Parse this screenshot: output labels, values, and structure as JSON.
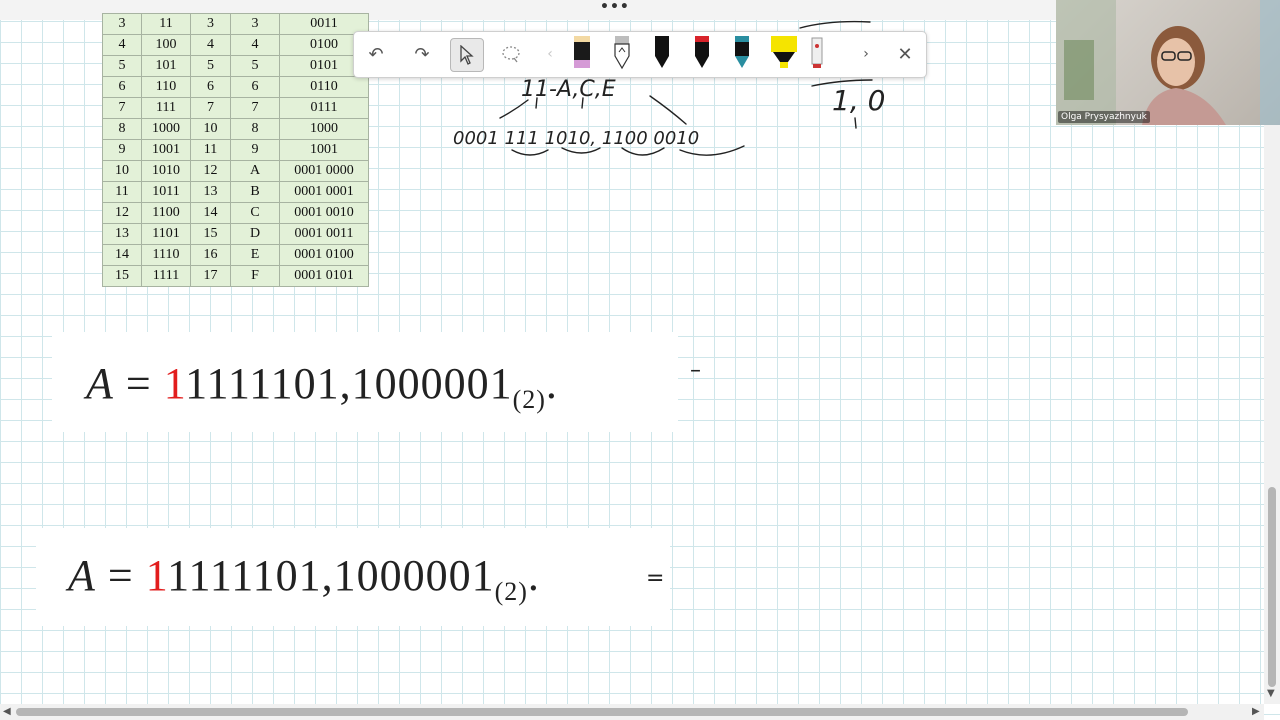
{
  "number_table": {
    "rows": [
      [
        "3",
        "11",
        "3",
        "3",
        "0011"
      ],
      [
        "4",
        "100",
        "4",
        "4",
        "0100"
      ],
      [
        "5",
        "101",
        "5",
        "5",
        "0101"
      ],
      [
        "6",
        "110",
        "6",
        "6",
        "0110"
      ],
      [
        "7",
        "111",
        "7",
        "7",
        "0111"
      ],
      [
        "8",
        "1000",
        "10",
        "8",
        "1000"
      ],
      [
        "9",
        "1001",
        "11",
        "9",
        "1001"
      ],
      [
        "10",
        "1010",
        "12",
        "A",
        "0001 0000"
      ],
      [
        "11",
        "1011",
        "13",
        "B",
        "0001 0001"
      ],
      [
        "12",
        "1100",
        "14",
        "C",
        "0001 0010"
      ],
      [
        "13",
        "1101",
        "15",
        "D",
        "0001 0011"
      ],
      [
        "14",
        "1110",
        "16",
        "E",
        "0001 0100"
      ],
      [
        "15",
        "1111",
        "17",
        "F",
        "0001 0101"
      ]
    ]
  },
  "handwriting": {
    "letters": "11-A,C,E",
    "groups": "0001 111 1010, 1100 0010",
    "top_right": "1, 0"
  },
  "toolbar": {
    "icons": [
      "undo-icon",
      "redo-icon",
      "select-pointer-icon",
      "lasso-icon",
      "scroll-left-icon",
      "pen-black-pink",
      "pencil-gray",
      "pen-black",
      "pen-red",
      "pen-teal",
      "highlighter-yellow",
      "ruler-eraser",
      "scroll-right-icon",
      "close-icon"
    ],
    "pen_colors": [
      "#1a1a1a",
      "#9a9a9a",
      "#111111",
      "#d8232a",
      "#2a8ea0",
      "#f5e400",
      "#cc3333"
    ]
  },
  "formula1": {
    "lhs": "A",
    "eq": "=",
    "mark": "1",
    "digits": "1111101,1000001",
    "sub": "(2)",
    "dot": ".",
    "dash": "–"
  },
  "formula2": {
    "lhs": "A",
    "eq": "=",
    "mark": "1",
    "digits": "1111101,1000001",
    "sub": "(2)",
    "dot": ".",
    "dash": "="
  },
  "participant": {
    "name": "Olga Prysyazhnyuk"
  },
  "topbar": {
    "menu": "•••"
  }
}
